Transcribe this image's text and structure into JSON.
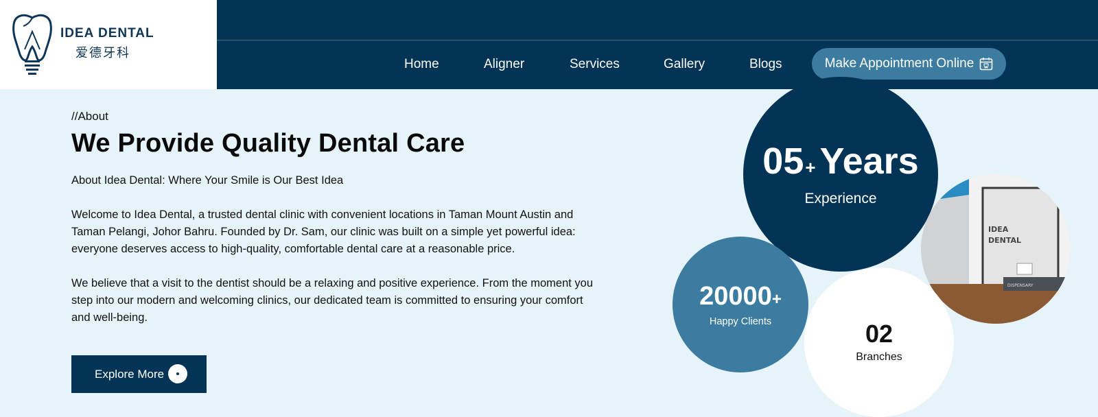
{
  "brand": {
    "name_en": "IDEA DENTAL",
    "name_zh": "爱德牙科",
    "logo_icon": "tooth-icon"
  },
  "nav": {
    "items": [
      {
        "label": "Home"
      },
      {
        "label": "Aligner"
      },
      {
        "label": "Services"
      },
      {
        "label": "Gallery"
      },
      {
        "label": "Blogs"
      }
    ],
    "cta_label": "Make Appointment Online",
    "cta_icon": "calendar-icon"
  },
  "about": {
    "kicker": "//About",
    "title": "We Provide Quality Dental Care",
    "subtitle": "About Idea Dental: Where Your Smile is Our Best Idea",
    "paragraph1": "Welcome to Idea Dental, a trusted dental clinic with convenient locations in Taman Mount Austin and Taman Pelangi, Johor Bahru. Founded by Dr. Sam, our clinic was built on a simple yet powerful idea: everyone deserves access to high-quality, comfortable dental care at a reasonable price.",
    "paragraph2": "We believe that a visit to the dentist should be a relaxing and positive experience. From the moment you step into our modern and welcoming clinics, our dedicated team is committed to ensuring your comfort and well-being.",
    "button_label": "Explore More"
  },
  "stats": {
    "years": {
      "number": "05",
      "plus": "+",
      "unit": "Years",
      "label": "Experience"
    },
    "clients": {
      "number": "20000",
      "plus": "+",
      "label": "Happy Clients"
    },
    "branches": {
      "number": "02",
      "label": "Branches"
    },
    "photo_sign": {
      "line1": "IDEA",
      "line2": "DENTAL",
      "desk": "DISPENSARY"
    }
  },
  "colors": {
    "navy": "#033456",
    "steel_blue": "#3c7ca1",
    "background": "#e6f3f9"
  }
}
